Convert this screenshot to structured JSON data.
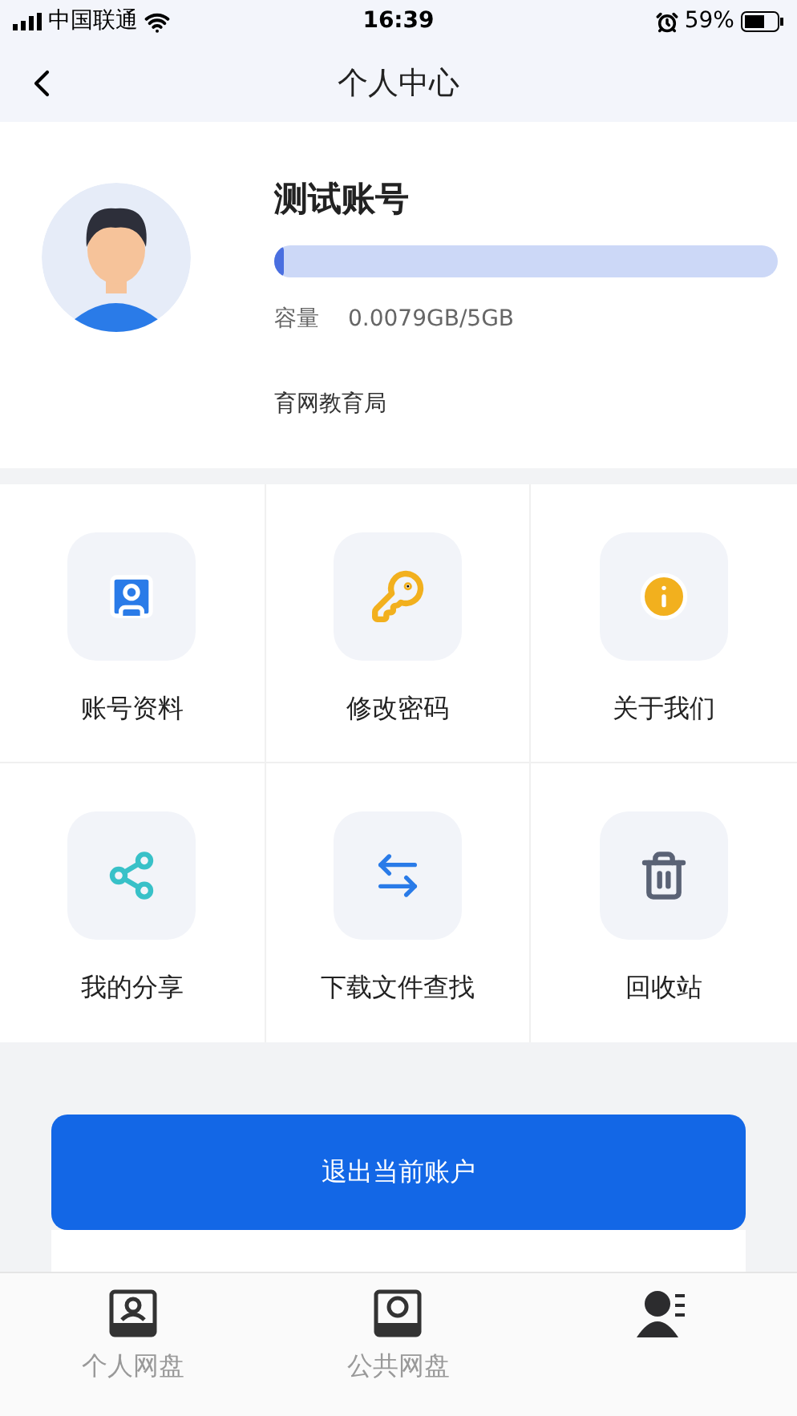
{
  "status_bar": {
    "carrier": "中国联通",
    "time": "16:39",
    "battery": "59%"
  },
  "nav": {
    "title": "个人中心"
  },
  "profile": {
    "name": "测试账号",
    "storage": {
      "level": 0.02,
      "label": "容量",
      "reading": "0.0079GB/5GB"
    },
    "organization": "育网教育局"
  },
  "menu": [
    {
      "kind": "profile",
      "label": "账号资料"
    },
    {
      "kind": "key",
      "label": "修改密码"
    },
    {
      "kind": "info",
      "label": "关于我们"
    },
    {
      "kind": "share",
      "label": "我的分享"
    },
    {
      "kind": "transfer",
      "label": "下载文件查找"
    },
    {
      "kind": "trash",
      "label": "回收站"
    }
  ],
  "logout_button": "退出当前账户",
  "tab_bar": [
    {
      "kind": "personal",
      "label": "个人网盘",
      "selected": false
    },
    {
      "kind": "public",
      "label": "公共网盘",
      "selected": false
    },
    {
      "kind": "me",
      "selected": true
    }
  ]
}
